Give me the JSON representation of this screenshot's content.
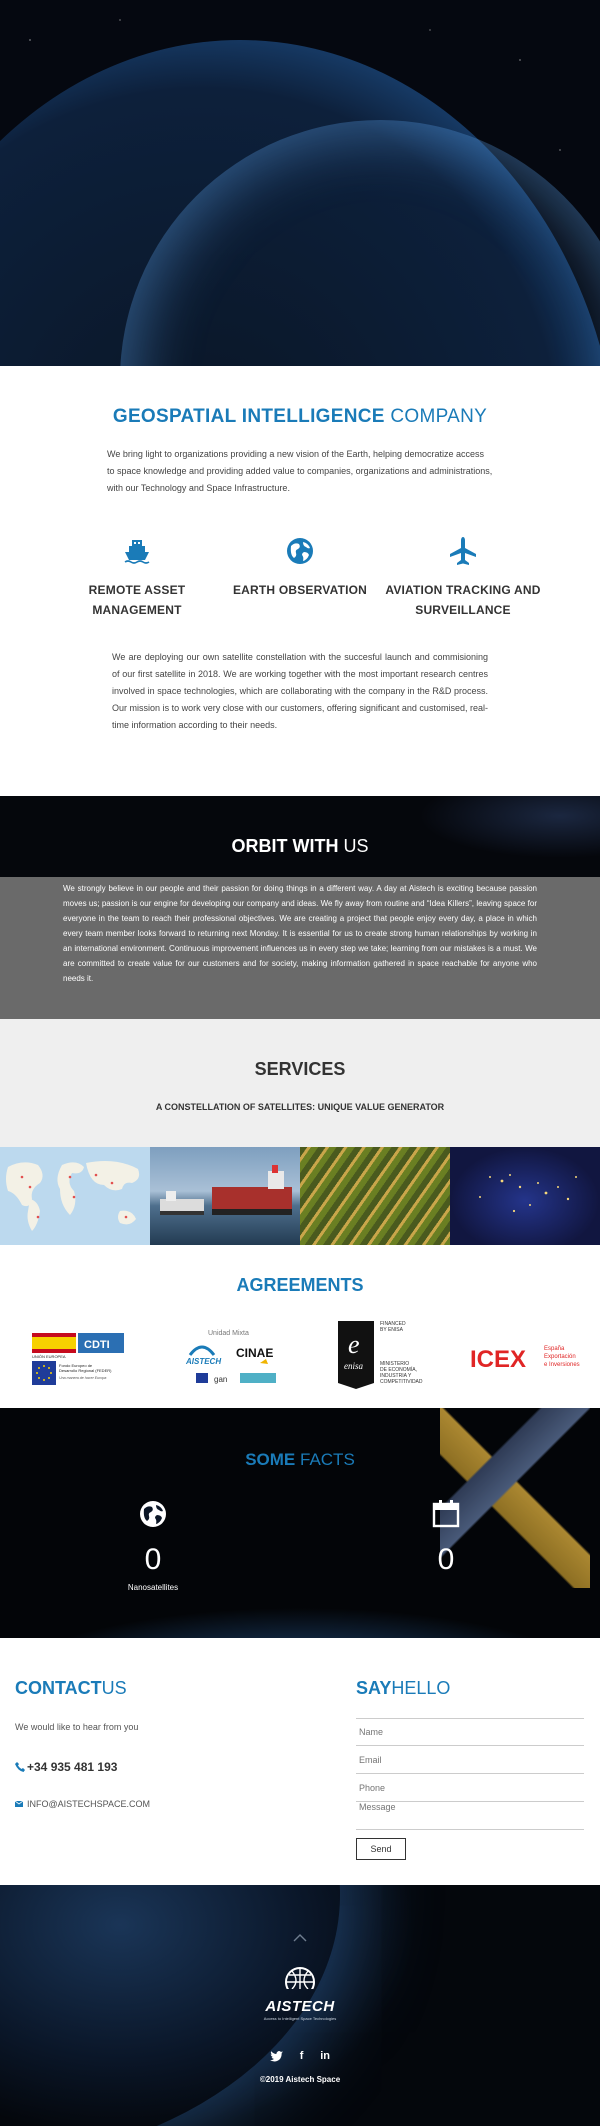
{
  "intro": {
    "title_bold": "GEOSPATIAL INTELLIGENCE",
    "title_thin": "COMPANY",
    "lead": "We bring light to organizations providing a new vision of the Earth, helping democratize access to space knowledge and providing added value to companies, organizations and administrations, with our Technology and Space Infrastructure.",
    "features": [
      {
        "icon": "ship-icon",
        "label": "REMOTE ASSET MANAGEMENT"
      },
      {
        "icon": "globe-icon",
        "label": "EARTH OBSERVATION"
      },
      {
        "icon": "plane-icon",
        "label": "AVIATION TRACKING AND SURVEILLANCE"
      }
    ],
    "body": "We are deploying our own satellite constellation with the succesful launch and commisioning of our first satellite in 2018. We are working together with the most important research centres involved in space technologies, which are collaborating with the company in the R&D process. Our mission is to work very close with our customers, offering significant and customised, real-time information according to their needs."
  },
  "orbit": {
    "title_bold": "ORBIT WITH",
    "title_thin": "US",
    "text": "We strongly believe in our people and their passion for doing things in a different way. A day at Aistech is exciting because passion moves us; passion is our engine for developing our company and ideas. We fly away from routine and “Idea Killers”, leaving space for everyone in the team to reach their professional objectives. We are creating a project that people enjoy every day, a place in which every team member looks forward to returning next Monday. It is essential for us to create strong human relationships by working in an international environment. Continuous improvement influences us in every step we take; learning from our mistakes is a must. We are committed to create value for our customers and for society, making information gathered in space reachable for anyone who needs it."
  },
  "services": {
    "title": "SERVICES",
    "subtitle": "A CONSTELLATION OF SATELLITES: UNIQUE VALUE GENERATOR"
  },
  "agreements": {
    "title": "AGREEMENTS",
    "logo1": {
      "cdti": "CDTI",
      "eu1": "UNIÓN EUROPEA",
      "eu2": "Fondo Europeo de",
      "eu3": "Desarrollo Regional (FEDER)",
      "eu4": "Una manera de hacer Europa"
    },
    "logo2": {
      "top": "Unidad Mixta",
      "aistech": "AISTECH",
      "cinae": "CINAE",
      "gan": "gan"
    },
    "logo3": {
      "fin1": "FINANCED",
      "fin2": "BY ENISA",
      "e": "e",
      "enisa": "enisa",
      "m1": "MINISTERIO",
      "m2": "DE ECONOMÍA,",
      "m3": "INDUSTRIA Y",
      "m4": "COMPETITIVIDAD"
    },
    "logo4": {
      "icex": "ICEX",
      "l1": "España",
      "l2": "Exportación",
      "l3": "e Inversiones"
    }
  },
  "facts": {
    "title_bold": "SOME",
    "title_thin": "FACTS",
    "items": [
      {
        "icon": "globe-icon",
        "value": "0",
        "caption": "Nanosatellites"
      },
      {
        "icon": "calendar-icon",
        "value": "0",
        "caption": ""
      }
    ]
  },
  "contact": {
    "title_bold": "CONTACT",
    "title_thin": "US",
    "subtitle": "We would like to hear from you",
    "phone": "+34 935 481 193",
    "email": "INFO@AISTECHSPACE.COM",
    "form_title_bold": "SAY",
    "form_title_thin": "HELLO",
    "name_placeholder": "Name",
    "email_placeholder": "Email",
    "phone_placeholder": "Phone",
    "message_placeholder": "Message",
    "send_label": "Send"
  },
  "footer": {
    "brand": "AISTECH",
    "tagline": "Access to Intelligent Space Technologies",
    "facebook": "f",
    "linkedin": "in",
    "copyright": "©2019 Aistech Space"
  },
  "colors": {
    "accent": "#1a7bb8",
    "dark": "#333333",
    "orbit_band": "#6a6a6a",
    "services_bg": "#efefef"
  }
}
